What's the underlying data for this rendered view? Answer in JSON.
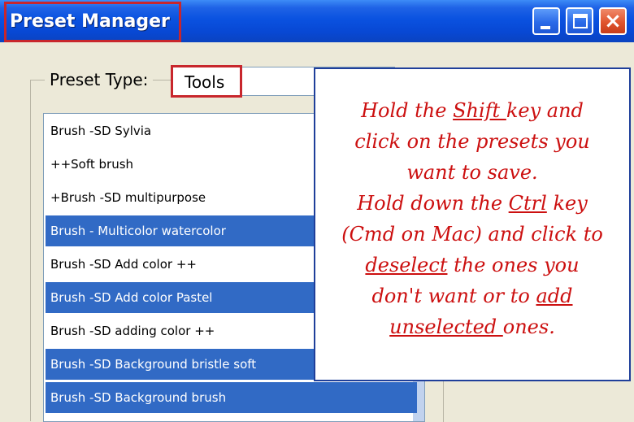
{
  "window": {
    "title": "Preset Manager",
    "buttons": {
      "minimize": "minimize",
      "maximize": "maximize",
      "close": "×"
    }
  },
  "preset_type": {
    "label": "Preset Type:",
    "value": "Tools"
  },
  "list": {
    "items": [
      {
        "label": "Brush -SD Sylvia",
        "selected": false
      },
      {
        "label": "++Soft brush",
        "selected": false
      },
      {
        "label": "+Brush -SD multipurpose",
        "selected": false
      },
      {
        "label": "Brush - Multicolor watercolor",
        "selected": true
      },
      {
        "label": "Brush -SD Add color ++",
        "selected": false
      },
      {
        "label": "Brush -SD Add color Pastel",
        "selected": true
      },
      {
        "label": "Brush -SD adding color ++",
        "selected": false
      },
      {
        "label": "Brush -SD Background bristle soft",
        "selected": true
      },
      {
        "label": "Brush -SD Background brush",
        "selected": true
      }
    ]
  },
  "callout": {
    "line1_a": "Hold the ",
    "line1_shift": "Shift ",
    "line1_b": "key and",
    "line2": "click on the presets you",
    "line3": "want to save.",
    "line4_a": "Hold down the ",
    "line4_ctrl": "Ctrl",
    "line4_b": " key",
    "line5": "(Cmd on Mac) and click to",
    "line6_deselect": "deselect",
    "line6_b": " the ones you",
    "line7_a": "don't want or to ",
    "line7_add": "add",
    "line8_unselected": "unselected ",
    "line8_b": "ones."
  },
  "colors": {
    "titlebar": "#0a52e0",
    "selection": "#316ac5",
    "annotation_red": "#cc1010"
  }
}
